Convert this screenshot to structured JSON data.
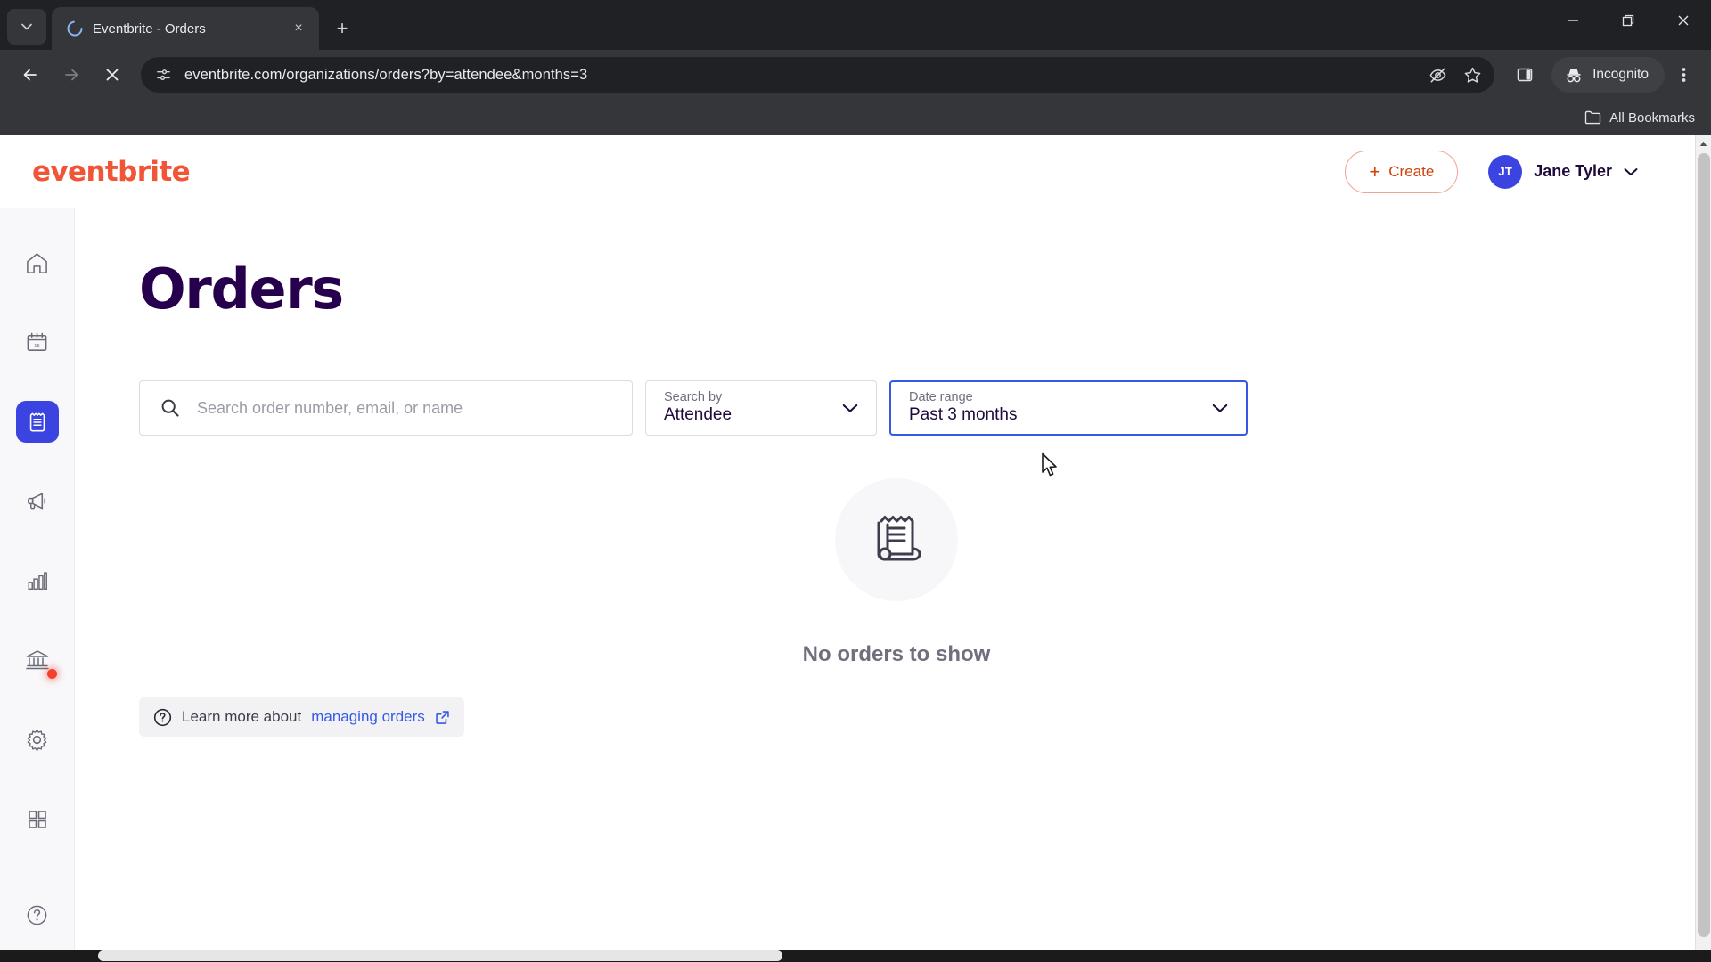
{
  "browser": {
    "tab": {
      "title": "Eventbrite - Orders",
      "favicon": "loading-spinner-icon",
      "close_label": "×",
      "new_tab_label": "+"
    },
    "tab_list_label": "▾",
    "window_controls": {
      "minimize": "—",
      "maximize": "❐",
      "close": "✕"
    },
    "toolbar": {
      "back_label": "←",
      "forward_label": "→",
      "stop_label": "✕",
      "url": "eventbrite.com/organizations/orders?by=attendee&months=3",
      "site_info_icon": "page-settings-icon",
      "tracking_icon": "eye-slash-icon",
      "bookmark_icon": "star-icon",
      "side_panel_icon": "side-panel-icon",
      "incognito_label": "Incognito",
      "incognito_icon": "incognito-hat-icon",
      "menu_icon": "three-dot-menu-icon"
    },
    "bookmarks": {
      "all_bookmarks_label": "All Bookmarks",
      "folder_icon": "folder-icon"
    }
  },
  "header": {
    "logo_text": "eventbrite",
    "logo_color": "#f05537",
    "create_label": "Create",
    "create_plus": "+",
    "user": {
      "initials": "JT",
      "name": "Jane Tyler",
      "avatar_color": "#3b44e0",
      "caret": "⌄"
    }
  },
  "sidebar": {
    "items": [
      {
        "name": "home",
        "icon": "home-icon",
        "active": false
      },
      {
        "name": "events",
        "icon": "calendar-icon",
        "active": false
      },
      {
        "name": "orders",
        "icon": "receipt-icon",
        "active": true
      },
      {
        "name": "marketing",
        "icon": "megaphone-icon",
        "active": false
      },
      {
        "name": "reports",
        "icon": "bar-chart-icon",
        "active": false
      },
      {
        "name": "finance",
        "icon": "bank-icon",
        "active": false,
        "badge": true
      },
      {
        "name": "settings",
        "icon": "gear-icon",
        "active": false
      }
    ],
    "bottom_items": [
      {
        "name": "apps",
        "icon": "grid-apps-icon"
      },
      {
        "name": "help",
        "icon": "question-circle-icon"
      }
    ],
    "active_color": "#3b44e0",
    "badge_color": "#f4402a"
  },
  "main": {
    "title": "Orders",
    "title_color": "#26004d",
    "search": {
      "placeholder": "Search order number, email, or name",
      "value": "",
      "icon": "search-icon"
    },
    "search_by": {
      "label": "Search by",
      "value": "Attendee",
      "caret": "⌄"
    },
    "date_range": {
      "label": "Date range",
      "value": "Past 3 months",
      "caret": "⌄",
      "focused": true,
      "focus_color": "#3659e3"
    },
    "empty_state": {
      "icon": "receipt-scroll-icon",
      "message": "No orders to show"
    },
    "learn_more": {
      "icon": "question-circle-icon",
      "prefix": "Learn more about ",
      "link_text": "managing orders",
      "external_icon": "external-link-icon",
      "link_color": "#3659e3"
    }
  }
}
